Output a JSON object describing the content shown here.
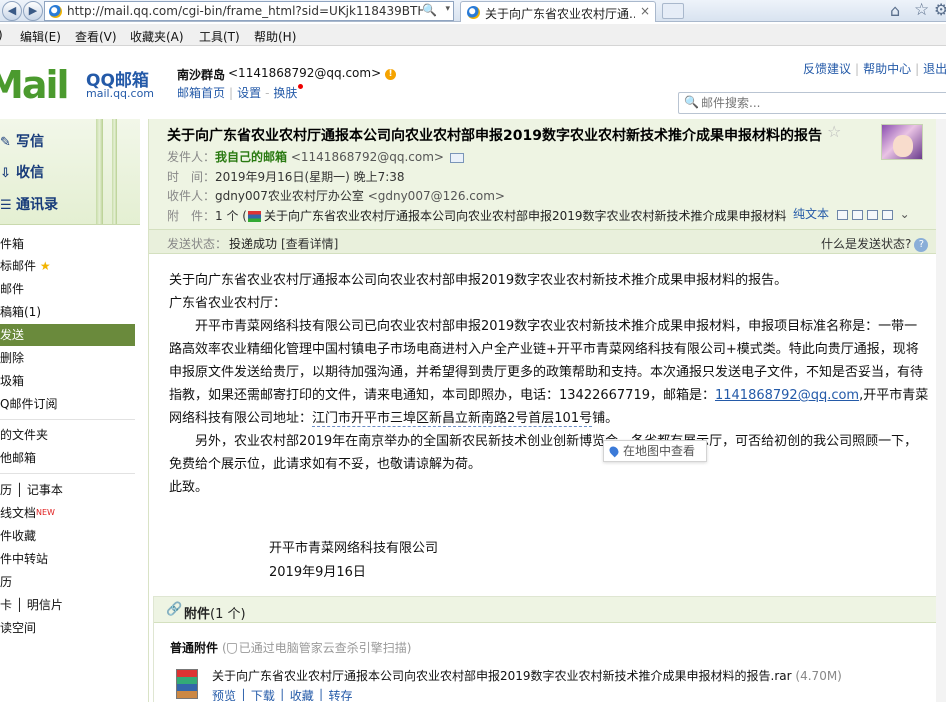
{
  "browser": {
    "url": "http://mail.qq.com/cgi-bin/frame_html?sid=UKjk118439BTH'",
    "tab_title": "关于向广东省农业农村厅通...",
    "close": "×",
    "search_glyph": "🔍",
    "drop_glyph": "▾"
  },
  "menubar": [
    "编辑(E)",
    "查看(V)",
    "收藏夹(A)",
    "工具(T)",
    "帮助(H)"
  ],
  "menubar_first": ")",
  "header": {
    "logo_big": "Mail",
    "logo_qq": "QQ邮箱",
    "logo_sub": "mail.qq.com",
    "user_name": "南沙群岛",
    "user_email": "<1141868792@qq.com>",
    "warn": "!",
    "links": [
      "邮箱首页",
      "设置",
      "换肤"
    ],
    "right_links": [
      "反馈建议",
      "帮助中心",
      "退出"
    ],
    "search_placeholder": "邮件搜索..."
  },
  "sidebar": {
    "actions": [
      {
        "icon": "✎",
        "label": "写信"
      },
      {
        "icon": "⇩",
        "label": "收信"
      },
      {
        "icon": "☰",
        "label": "通讯录"
      }
    ],
    "items": [
      {
        "label": "件箱"
      },
      {
        "label": "标邮件"
      },
      {
        "label": "邮件"
      },
      {
        "label": "稿箱(1)"
      },
      {
        "label": "发送"
      },
      {
        "label": "删除"
      },
      {
        "label": "圾箱"
      },
      {
        "label": "Q邮件订阅"
      },
      {
        "label": "的文件夹"
      },
      {
        "label": "他邮箱"
      },
      {
        "label": "历 │ 记事本"
      },
      {
        "label": "线文档"
      },
      {
        "label": "件收藏"
      },
      {
        "label": "件中转站"
      },
      {
        "label": "历"
      },
      {
        "label": "卡 │ 明信片"
      },
      {
        "label": "读空间"
      }
    ],
    "star": "★",
    "new_tag": "NEW"
  },
  "mail": {
    "subject": "关于向广东省农业农村厅通报本公司向农业农村部申报2019数字农业农村新技术推介成果申报材料的报告",
    "star": "☆",
    "sender_label": "发件人：",
    "sender_name": "我自己的邮箱",
    "sender_email": "<1141868792@qq.com>",
    "time_label": "时　间：",
    "time": "2019年9月16日(星期一) 晚上7:38",
    "to_label": "收件人：",
    "to_name": "gdny007农业农村厅办公室",
    "to_email": "<gdny007@126.com>",
    "attach_label": "附　件：",
    "attach_count": "1 个 (",
    "attach_name": "关于向广东省农业农村厅通报本公司向农业农村部申报2019数字农业农村新技术推介成果申报材料",
    "plain_text": "纯文本",
    "chevron": "⌄",
    "status_label": "发送状态：",
    "status_value": "投递成功",
    "status_detail": "[查看详情]",
    "status_help": "什么是发送状态?",
    "status_q": "?"
  },
  "body": {
    "line1": "关于向广东省农业农村厅通报本公司向农业农村部申报2019数字农业农村新技术推介成果申报材料的报告。",
    "line2": "广东省农业农村厅：",
    "p1_a": "开平市青菜网络科技有限公司已向农业农村部申报2019数字农业农村新技术推介成果申报材料，申报项目标准名称是：一带一路高效率农业精细化管理中国村镇电子市场电商进村入户全产业链+开平市青菜网络科技有限公司+模式类。特此向贵厅通报，现将申报原文件发送给贵厅，以期待加强沟通，并希望得到贵厅更多的政策帮助和支持。本次通报只发送电子文件，不知是否妥当，有待指教，如果还需邮寄打印的文件，请来电通知，本司即照办，电话：13422667719，邮箱是：",
    "email_link": "1141868792@qq.com",
    "p1_b": ",开平市青菜网络科技有限公司地址：",
    "address": "江门市开平市三埠区新昌立新南路2号首层101号",
    "p1_c": "铺。",
    "p2": "另外，农业农村部2019年在南京举办的全国新农民新技术创业创新博览会，各省都有展示厅，可否给初创的我公司照顾一下，免费给个展示位，此请求如有不妥，也敬请谅解为荷。",
    "closing": "此致。",
    "sign_company": "开平市青菜网络科技有限公司",
    "sign_date": "2019年9月16日",
    "map_tip": "在地图中查看"
  },
  "attachments": {
    "title": "附件",
    "count": "(1 个)",
    "clip": "🔗",
    "normal_label": "普通附件",
    "scan_note": "已通过电脑管家云查杀引擎扫描)",
    "scan_open": "(",
    "file_name": "关于向广东省农业农村厅通报本公司向农业农村部申报2019数字农业农村新技术推介成果申报材料的报告.rar",
    "file_size": "(4.70M)",
    "file_actions": "预览 │ 下载 │ 收藏 │ 转存"
  }
}
